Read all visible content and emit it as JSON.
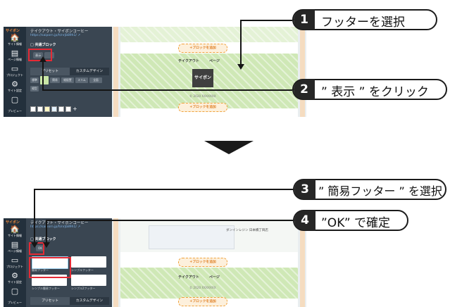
{
  "callouts": {
    "c1": {
      "num": "1",
      "text": "フッターを選択"
    },
    "c2": {
      "num": "2",
      "text": "” 表示 ” をクリック"
    },
    "c3": {
      "num": "3",
      "text": "” 簡易フッター ” を選択"
    },
    "c4": {
      "num": "4",
      "text": "”OK” で確定"
    }
  },
  "screen": {
    "brand": "サイボン",
    "nav": [
      "サイト情報",
      "ページ情報",
      "プロジェクト",
      "サイト設定"
    ],
    "nav_preview": "プレビュー",
    "site_title": "テイクアウト・サイボンコーヒー",
    "site_url": "https://saiporn.jp/h/nrjb89h1/ ↗",
    "section_label": "□ 共通ブロック",
    "display_chip": "表示",
    "ok_chip": "OK",
    "tabs": [
      "プリセット",
      "カスタムデザイン"
    ],
    "row_pills": [
      "標準",
      "",
      "簡易",
      "縦配置",
      "スリム",
      "全面"
    ],
    "row_pills2": [
      "縦型"
    ],
    "footer_options": [
      "簡易フッター",
      "シンプルフッター",
      "シンプル簡易フッター",
      "シンプル2フッター"
    ],
    "add_block": "+ブロックを追加",
    "footer_nav": [
      "テイクアウト",
      "ページ"
    ],
    "logo_text": "サイボン",
    "copyright": "© 2020 XXXXXXX",
    "map_label": "ダンインレジン 日本橋丁目店"
  },
  "colors": {
    "highlight": "#e52a35",
    "accent_orange": "#f0a23c"
  }
}
